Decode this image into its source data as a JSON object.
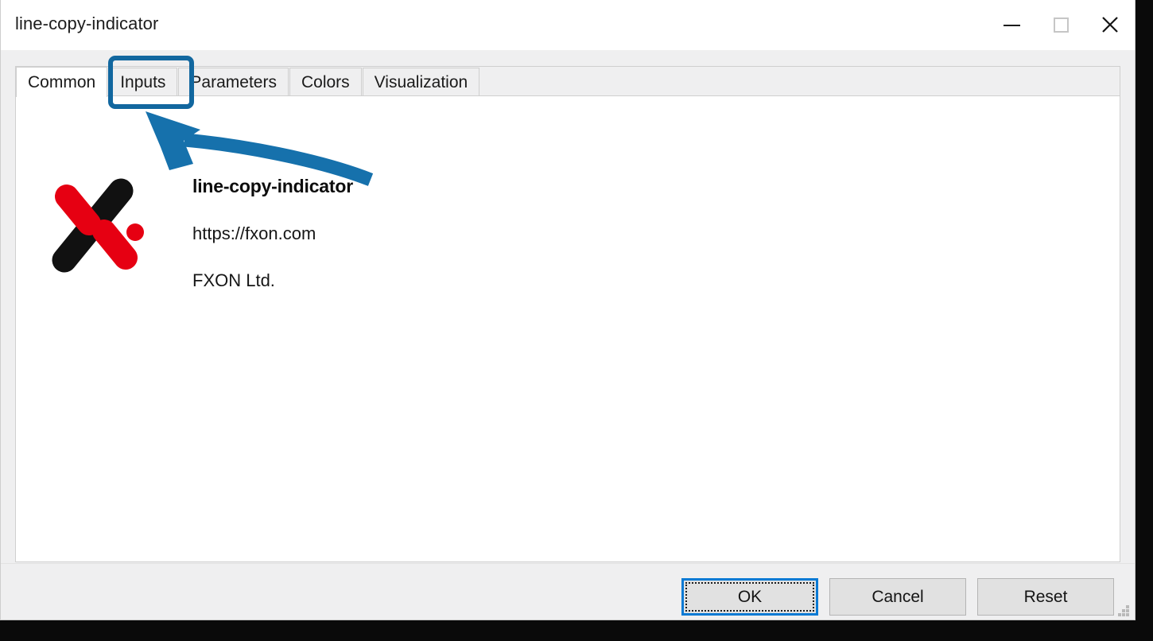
{
  "window": {
    "title": "line-copy-indicator",
    "controls": [
      {
        "name": "minimize",
        "icon": "minimize-icon",
        "label": "—"
      },
      {
        "name": "maximize",
        "icon": "maximize-icon",
        "label": "□"
      },
      {
        "name": "close",
        "icon": "close-icon",
        "label": "✕"
      }
    ]
  },
  "tabs": [
    {
      "label": "Common",
      "selected": true
    },
    {
      "label": "Inputs",
      "selected": false
    },
    {
      "label": "Parameters",
      "selected": false
    },
    {
      "label": "Colors",
      "selected": false
    },
    {
      "label": "Visualization",
      "selected": false
    }
  ],
  "about": {
    "logo_name": "fxon-logo",
    "product_name": "line-copy-indicator",
    "url": "https://fxon.com",
    "company": "FXON Ltd.",
    "logo_colors": {
      "black": "#111111",
      "red": "#e60012"
    }
  },
  "footer": {
    "buttons": [
      {
        "label": "OK",
        "default": true
      },
      {
        "label": "Cancel",
        "default": false
      },
      {
        "label": "Reset",
        "default": false
      }
    ]
  },
  "annotation": {
    "highlight_target": "Inputs",
    "arrow_name": "callout-arrow",
    "color": "#12679f"
  },
  "colors": {
    "accent_blue": "#0a7ad4",
    "annotation_blue": "#12679f",
    "dialog_bg": "#efeff0",
    "page_bg": "#ffffff",
    "button_bg": "#e1e1e1"
  }
}
